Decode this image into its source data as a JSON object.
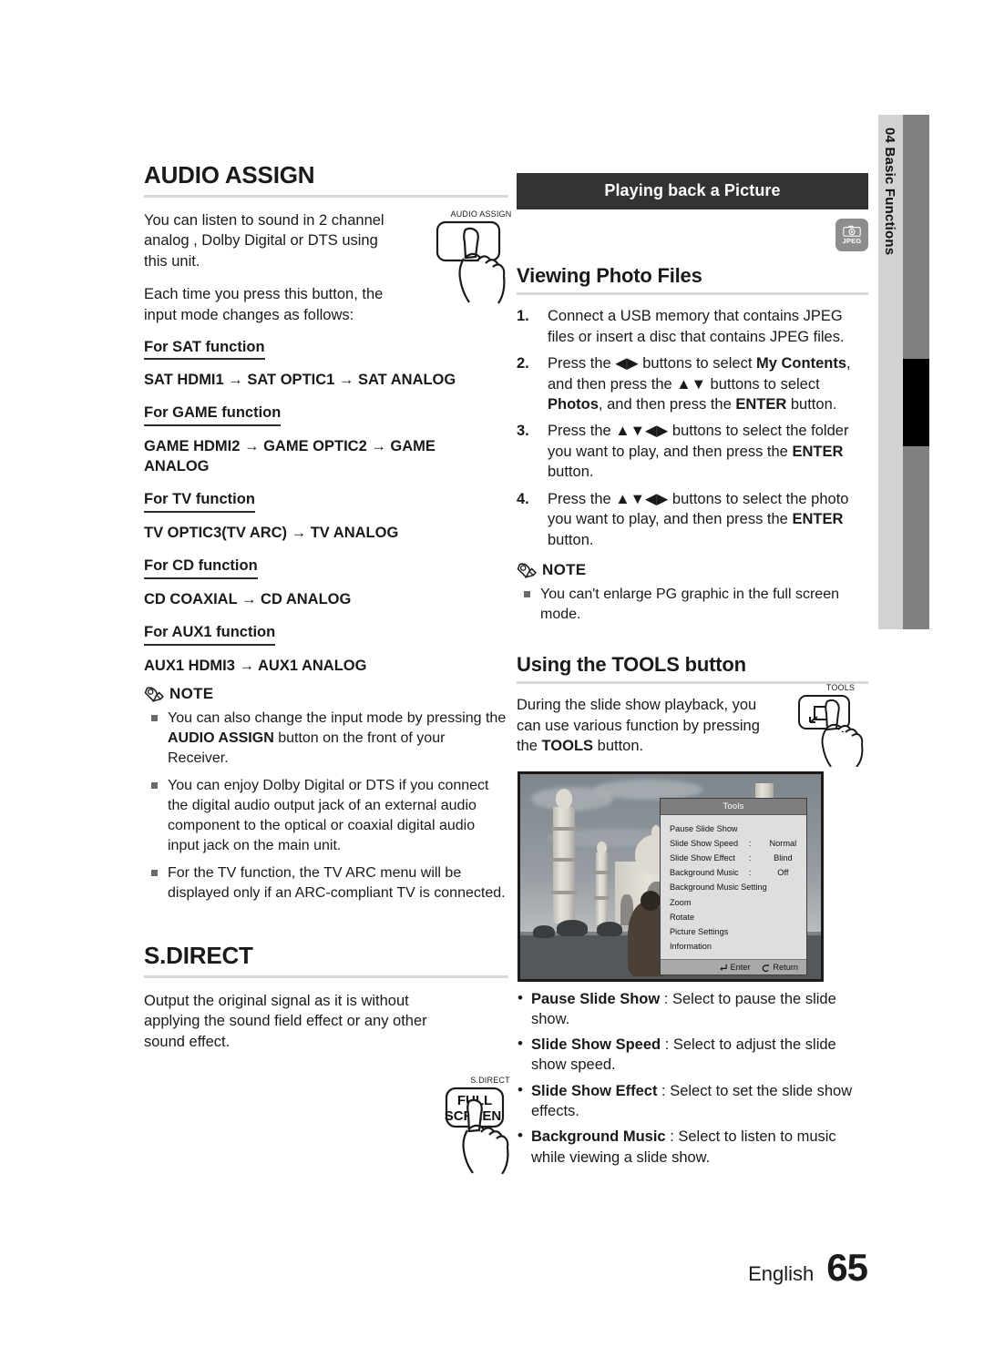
{
  "side_tab": {
    "number": "04",
    "label": "Basic Functions",
    "text": "04  Basic Functions"
  },
  "left_column": {
    "section1": {
      "title": "AUDIO ASSIGN",
      "paragraphs": [
        "You can listen to sound in 2 channel analog , Dolby Digital or DTS using this unit.",
        "Each time you press this button, the input mode changes as follows:"
      ],
      "button_illustration": {
        "caption": "AUDIO ASSIGN"
      },
      "functions": [
        {
          "head": "For SAT function",
          "chain": "SAT HDMI1 → SAT OPTIC1 → SAT ANALOG"
        },
        {
          "head": "For GAME function",
          "chain": "GAME HDMI2 → GAME OPTIC2 → GAME ANALOG"
        },
        {
          "head": "For TV function",
          "chain": "TV OPTIC3(TV ARC) → TV ANALOG"
        },
        {
          "head": "For CD function",
          "chain": "CD COAXIAL → CD ANALOG"
        },
        {
          "head": "For AUX1 function",
          "chain": "AUX1 HDMI3 → AUX1 ANALOG"
        }
      ],
      "note": {
        "label": "NOTE",
        "items": [
          {
            "pre": "You can also change the input mode by pressing the ",
            "bold": "AUDIO ASSIGN",
            "post": " button on the front of your Receiver."
          },
          {
            "pre": "You can enjoy Dolby Digital or DTS if you connect the digital audio output jack of an external audio component to the optical or coaxial digital audio input jack on the main unit.",
            "bold": "",
            "post": ""
          },
          {
            "pre": "For the TV function, the TV ARC menu will be displayed only if an ARC-compliant TV is connected.",
            "bold": "",
            "post": ""
          }
        ]
      }
    },
    "section2": {
      "title": "S.DIRECT",
      "paragraph": "Output the original signal as it is without applying the sound field effect or any other sound effect.",
      "button_illustration": {
        "caption": "S.DIRECT",
        "line1": "FULL",
        "line2": "SCREEN"
      }
    }
  },
  "right_column": {
    "banner": "Playing back a Picture",
    "media_badge": {
      "icon": "camera-icon",
      "label": "JPEG"
    },
    "heading1": "Viewing Photo Files",
    "steps": [
      {
        "num": "1.",
        "html": "Connect a USB memory that contains JPEG files or insert a disc that contains JPEG files."
      },
      {
        "num": "2.",
        "html": "Press the ◀▶ buttons to select <b>My Contents</b>, and then press the ▲▼ buttons to select <b>Photos</b>, and then press the <b>ENTER</b> button."
      },
      {
        "num": "3.",
        "html": "Press the ▲▼◀▶ buttons to select the folder you want to play, and then press the <b>ENTER</b> button."
      },
      {
        "num": "4.",
        "html": "Press the ▲▼◀▶ buttons to select the photo you want to play, and then press the <b>ENTER</b> button."
      }
    ],
    "note": {
      "label": "NOTE",
      "items": [
        "You can't enlarge PG graphic in the full screen mode."
      ]
    },
    "heading2": "Using the TOOLS button",
    "tools_paragraph": {
      "pre": "During the slide show playback, you can use various function by pressing the ",
      "bold": "TOOLS",
      "post": " button."
    },
    "button_illustration": {
      "caption": "TOOLS"
    },
    "tv_screen": {
      "photo_description": "Taj Mahal photograph, black and white",
      "osd": {
        "title": "Tools",
        "rows": [
          {
            "label": "Pause Slide Show",
            "sep": "",
            "value": ""
          },
          {
            "label": "Slide Show Speed",
            "sep": ":",
            "value": "Normal"
          },
          {
            "label": "Slide Show Effect",
            "sep": ":",
            "value": "Blind"
          },
          {
            "label": "Background Music",
            "sep": ":",
            "value": "Off"
          },
          {
            "label": "Background Music Setting",
            "sep": "",
            "value": ""
          },
          {
            "label": "Zoom",
            "sep": "",
            "value": ""
          },
          {
            "label": "Rotate",
            "sep": "",
            "value": ""
          },
          {
            "label": "Picture Settings",
            "sep": "",
            "value": ""
          },
          {
            "label": "Information",
            "sep": "",
            "value": ""
          }
        ],
        "footer": [
          {
            "icon": "enter-icon",
            "label": "Enter"
          },
          {
            "icon": "return-icon",
            "label": "Return"
          }
        ]
      }
    },
    "tool_descriptions": [
      {
        "term": "Pause Slide Show",
        "desc": " : Select to pause the slide show."
      },
      {
        "term": "Slide Show Speed",
        "desc": " : Select to adjust the slide show speed."
      },
      {
        "term": "Slide Show Effect",
        "desc": " : Select to set the slide show effects."
      },
      {
        "term": "Background Music",
        "desc": " : Select to listen to music while viewing a slide show."
      }
    ]
  },
  "footer": {
    "language": "English",
    "page": "65"
  }
}
